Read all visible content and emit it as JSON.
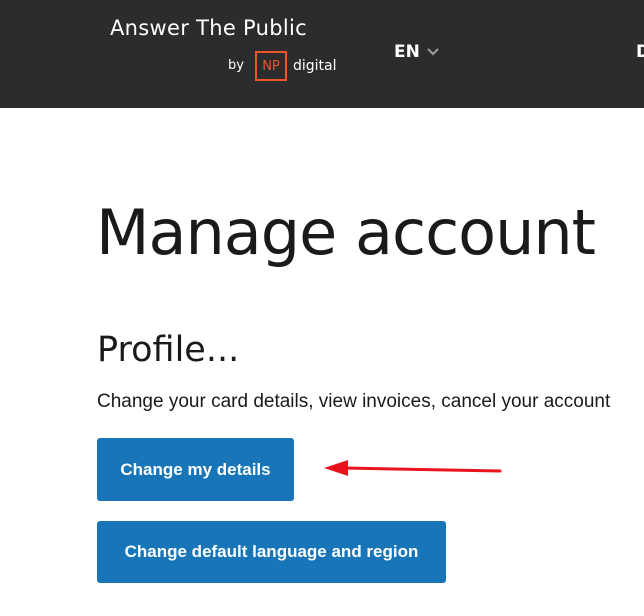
{
  "header": {
    "brand_title": "Answer The Public",
    "brand_by": "by",
    "brand_np": "NP",
    "brand_digital": "digital",
    "language": "EN",
    "nav_partial": "D"
  },
  "main": {
    "page_title": "Manage account",
    "profile": {
      "title": "Profile...",
      "description": "Change your card details, view invoices, cancel your account",
      "change_details_label": "Change my details",
      "change_language_label": "Change default language and region"
    }
  },
  "icons": {
    "language_dropdown": "chevron-down-icon",
    "annotation": "red-arrow-icon"
  },
  "colors": {
    "header_bg": "#2c2c2e",
    "brand_accent": "#e9572b",
    "button_bg": "#1876b8",
    "annotation_arrow": "#e8141c"
  }
}
